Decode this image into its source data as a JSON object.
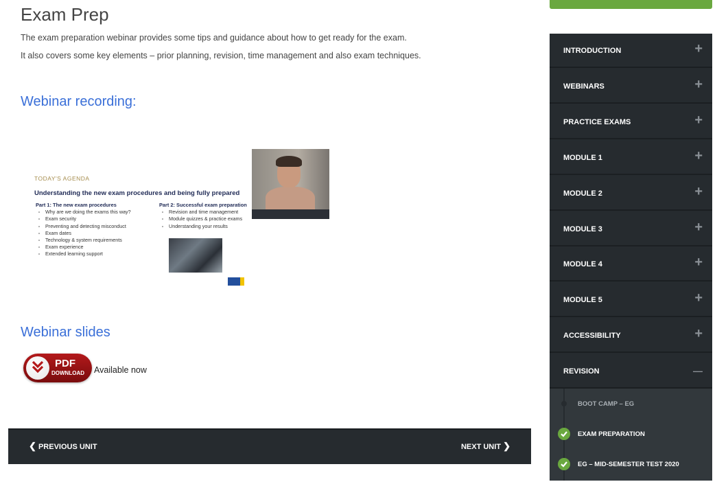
{
  "page": {
    "title": "Exam Prep",
    "intro_1": "The exam preparation webinar provides some tips and guidance about how to get ready for the exam.",
    "intro_2": "It also covers some key elements – prior planning, revision, time management and also exam techniques.",
    "recording_heading": "Webinar recording:",
    "slides_heading": "Webinar slides"
  },
  "video": {
    "agenda": "TODAY'S AGENDA",
    "title": "Understanding the new exam procedures and being fully prepared",
    "part1_heading": "Part 1: The new exam procedures",
    "part1_items": [
      "Why are we doing the exams this way?",
      "Exam security",
      "Preventing and detecting misconduct",
      "Exam dates",
      "Technology & system requirements",
      "Exam experience",
      "Extended learning support"
    ],
    "part2_heading": "Part 2: Successful exam preparation",
    "part2_items": [
      "Revision and time management",
      "Module quizzes & practice exams",
      "Understanding your results"
    ]
  },
  "pdf": {
    "label_top": "PDF",
    "label_bottom": "DOWNLOAD",
    "status": "Available now"
  },
  "unit_nav": {
    "prev": "PREVIOUS UNIT",
    "next": "NEXT UNIT"
  },
  "sidebar": {
    "items": [
      {
        "label": "INTRODUCTION",
        "toggle": "+"
      },
      {
        "label": "WEBINARS",
        "toggle": "+"
      },
      {
        "label": "PRACTICE EXAMS",
        "toggle": "+"
      },
      {
        "label": "MODULE 1",
        "toggle": "+"
      },
      {
        "label": "MODULE 2",
        "toggle": "+"
      },
      {
        "label": "MODULE 3",
        "toggle": "+"
      },
      {
        "label": "MODULE 4",
        "toggle": "+"
      },
      {
        "label": "MODULE 5",
        "toggle": "+"
      },
      {
        "label": "ACCESSIBILITY",
        "toggle": "+"
      },
      {
        "label": "REVISION",
        "toggle": "—"
      }
    ],
    "sub_items": [
      {
        "label": "BOOT CAMP – EG",
        "completed": false
      },
      {
        "label": "EXAM PREPARATION",
        "completed": true
      },
      {
        "label": "EG – MID-SEMESTER TEST 2020",
        "completed": true
      }
    ]
  },
  "colors": {
    "accent_blue": "#3a6fd8",
    "dark_panel": "#262b2f",
    "green": "#6aa83f"
  }
}
